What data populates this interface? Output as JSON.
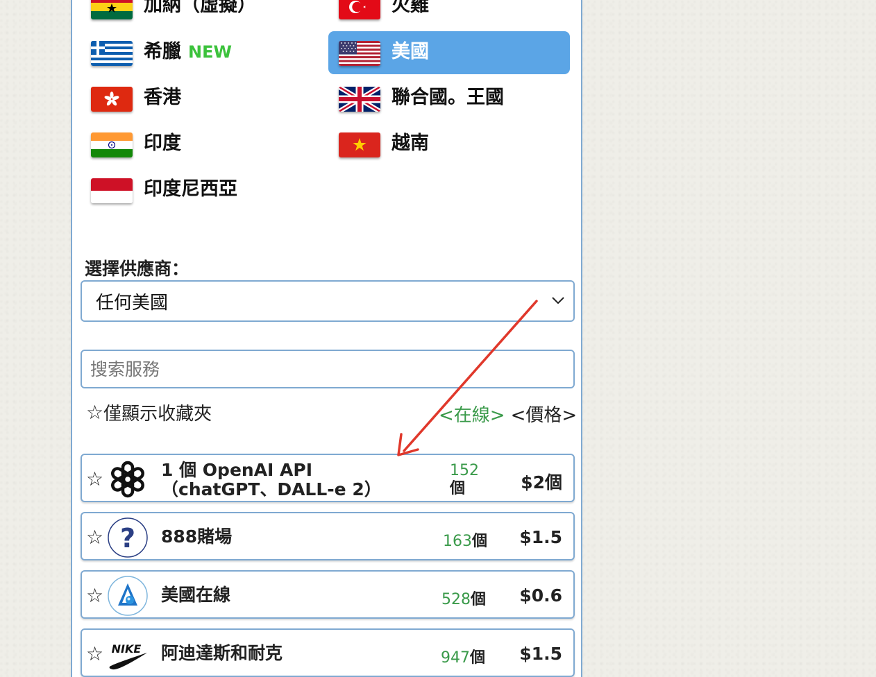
{
  "countries": [
    {
      "label": "加納（虛擬）",
      "flag": "ghana"
    },
    {
      "label": "火雞",
      "flag": "turkey"
    },
    {
      "label": "希臘",
      "flag": "greece",
      "badge": "NEW"
    },
    {
      "label": "美國",
      "flag": "usa",
      "selected": true
    },
    {
      "label": "香港",
      "flag": "hongkong"
    },
    {
      "label": "聯合國。王國",
      "flag": "uk"
    },
    {
      "label": "印度",
      "flag": "india"
    },
    {
      "label": "越南",
      "flag": "vietnam"
    },
    {
      "label": "印度尼西亞",
      "flag": "indonesia"
    }
  ],
  "provider": {
    "label": "選擇供應商：",
    "selected": "任何美國"
  },
  "search": {
    "placeholder": "搜索服務"
  },
  "filters": {
    "favorites_star": "☆",
    "favorites_label": "僅顯示收藏夾",
    "sort_online": "<在線>",
    "sort_price": "<價格>"
  },
  "services": [
    {
      "name": "1 個 OpenAI API（chatGPT、DALL-e 2）",
      "count": "152",
      "unit": "個",
      "price": "$2個",
      "logo": "openai-logo"
    },
    {
      "name": "888賭場",
      "count": "163",
      "unit": "個",
      "price": "$1.5",
      "logo": "question-logo"
    },
    {
      "name": "美國在線",
      "count": "528",
      "unit": "個",
      "price": "$0.6",
      "logo": "aol-logo"
    },
    {
      "name": "阿迪達斯和耐克",
      "count": "947",
      "unit": "個",
      "price": "$1.5",
      "logo": "nike-logo"
    }
  ],
  "colors": {
    "accent": "#5ba5e6",
    "border": "#7fa9d1",
    "online_green": "#3a9a4a",
    "new_green": "#3cc23c",
    "arrow_red": "#e0382b"
  }
}
